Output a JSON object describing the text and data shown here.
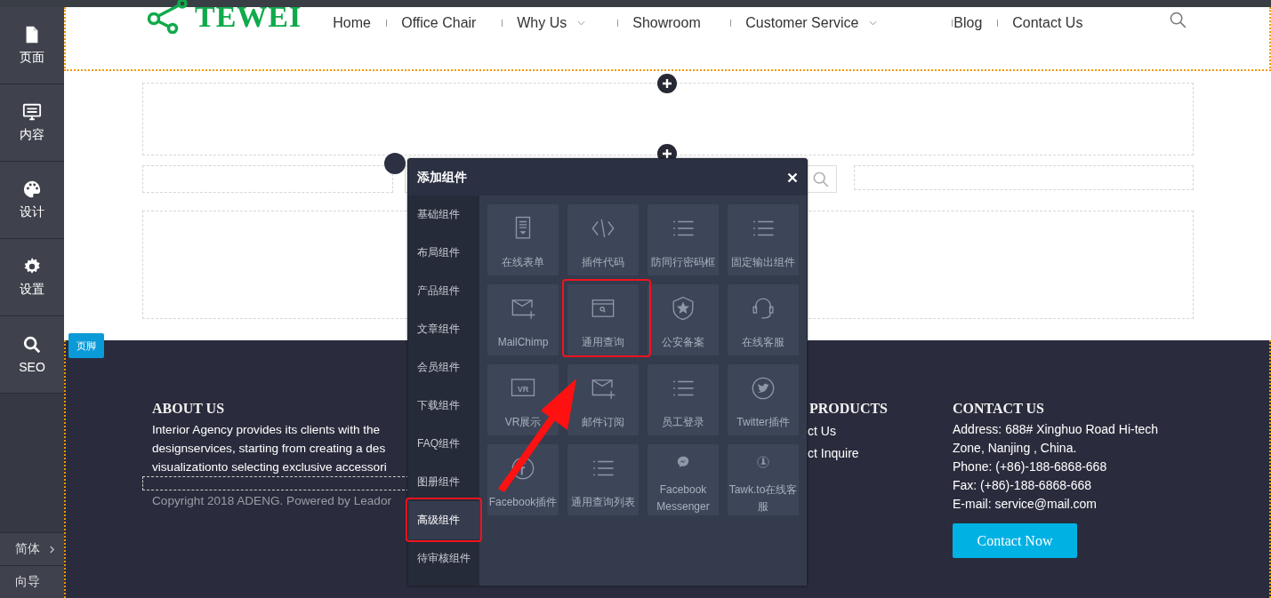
{
  "sidebar": {
    "items": [
      {
        "label": "页面",
        "kind": "page"
      },
      {
        "label": "内容",
        "kind": "content"
      },
      {
        "label": "设计",
        "kind": "palette"
      },
      {
        "label": "设置",
        "kind": "gear"
      },
      {
        "label": "SEO",
        "kind": "search"
      }
    ],
    "language": "简体",
    "guide": "向导"
  },
  "header": {
    "logo": "TEWEI",
    "nav": [
      {
        "label": "Home",
        "dropdown": false
      },
      {
        "label": "Office Chair",
        "dropdown": false
      },
      {
        "label": "Why Us",
        "dropdown": true
      },
      {
        "label": "Showroom",
        "dropdown": false
      },
      {
        "label": "Customer Service",
        "dropdown": true
      },
      {
        "label": "Blog",
        "dropdown": false
      },
      {
        "label": "Contact Us",
        "dropdown": false
      }
    ]
  },
  "footer": {
    "badge": "页脚",
    "about": {
      "title": "ABOUT US",
      "lines": [
        "Interior Agency provides its clients with the",
        "designservices, starting from creating a des",
        "visualizationto selecting exclusive accessori"
      ]
    },
    "copyright": "Copyright 2018 ADENG. Powered by Leador",
    "products": {
      "title": "PRODUCTS",
      "links": [
        "ct Us",
        "ct Inquire"
      ]
    },
    "contact": {
      "title": "CONTACT US",
      "lines": [
        "Address: 688# Xinghuo Road Hi-tech",
        "Zone, Nanjing , China.",
        "Phone: (+86)-188-6868-668",
        "Fax: (+86)-188-6868-668",
        "E-mail:  service@mail.com"
      ],
      "button": "Contact Now"
    }
  },
  "dialog": {
    "title": "添加组件",
    "categories": [
      {
        "label": "基础组件",
        "selected": false,
        "annotated": false
      },
      {
        "label": "布局组件",
        "selected": false,
        "annotated": false
      },
      {
        "label": "产品组件",
        "selected": false,
        "annotated": false
      },
      {
        "label": "文章组件",
        "selected": false,
        "annotated": false
      },
      {
        "label": "会员组件",
        "selected": false,
        "annotated": false
      },
      {
        "label": "下载组件",
        "selected": false,
        "annotated": false
      },
      {
        "label": "FAQ组件",
        "selected": false,
        "annotated": false
      },
      {
        "label": "图册组件",
        "selected": false,
        "annotated": false
      },
      {
        "label": "高级组件",
        "selected": true,
        "annotated": true
      },
      {
        "label": "待审核组件",
        "selected": false,
        "annotated": false
      }
    ],
    "components": [
      {
        "label": "在线表单",
        "kind": "form",
        "annotated": false
      },
      {
        "label": "插件代码",
        "kind": "code",
        "annotated": false
      },
      {
        "label": "防同行密码框",
        "kind": "list",
        "annotated": false
      },
      {
        "label": "固定输出组件",
        "kind": "list",
        "annotated": false
      },
      {
        "label": "MailChimp",
        "kind": "mail",
        "annotated": false
      },
      {
        "label": "通用查询",
        "kind": "searchwin",
        "annotated": true
      },
      {
        "label": "公安备案",
        "kind": "shield",
        "annotated": false
      },
      {
        "label": "在线客服",
        "kind": "headset",
        "annotated": false
      },
      {
        "label": "VR展示",
        "kind": "vr",
        "icon_text": "VR",
        "annotated": false
      },
      {
        "label": "邮件订阅",
        "kind": "mail",
        "annotated": false
      },
      {
        "label": "员工登录",
        "kind": "list",
        "annotated": false
      },
      {
        "label": "Twitter插件",
        "kind": "bird",
        "annotated": false
      },
      {
        "label": "Facebook插件",
        "kind": "fcircle",
        "annotated": false
      },
      {
        "label": "通用查询列表",
        "kind": "list",
        "annotated": false
      },
      {
        "label": "Facebook Messenger",
        "kind": "chat",
        "annotated": false
      },
      {
        "label": "Tawk.to在线客服",
        "kind": "boot",
        "annotated": false
      }
    ]
  }
}
